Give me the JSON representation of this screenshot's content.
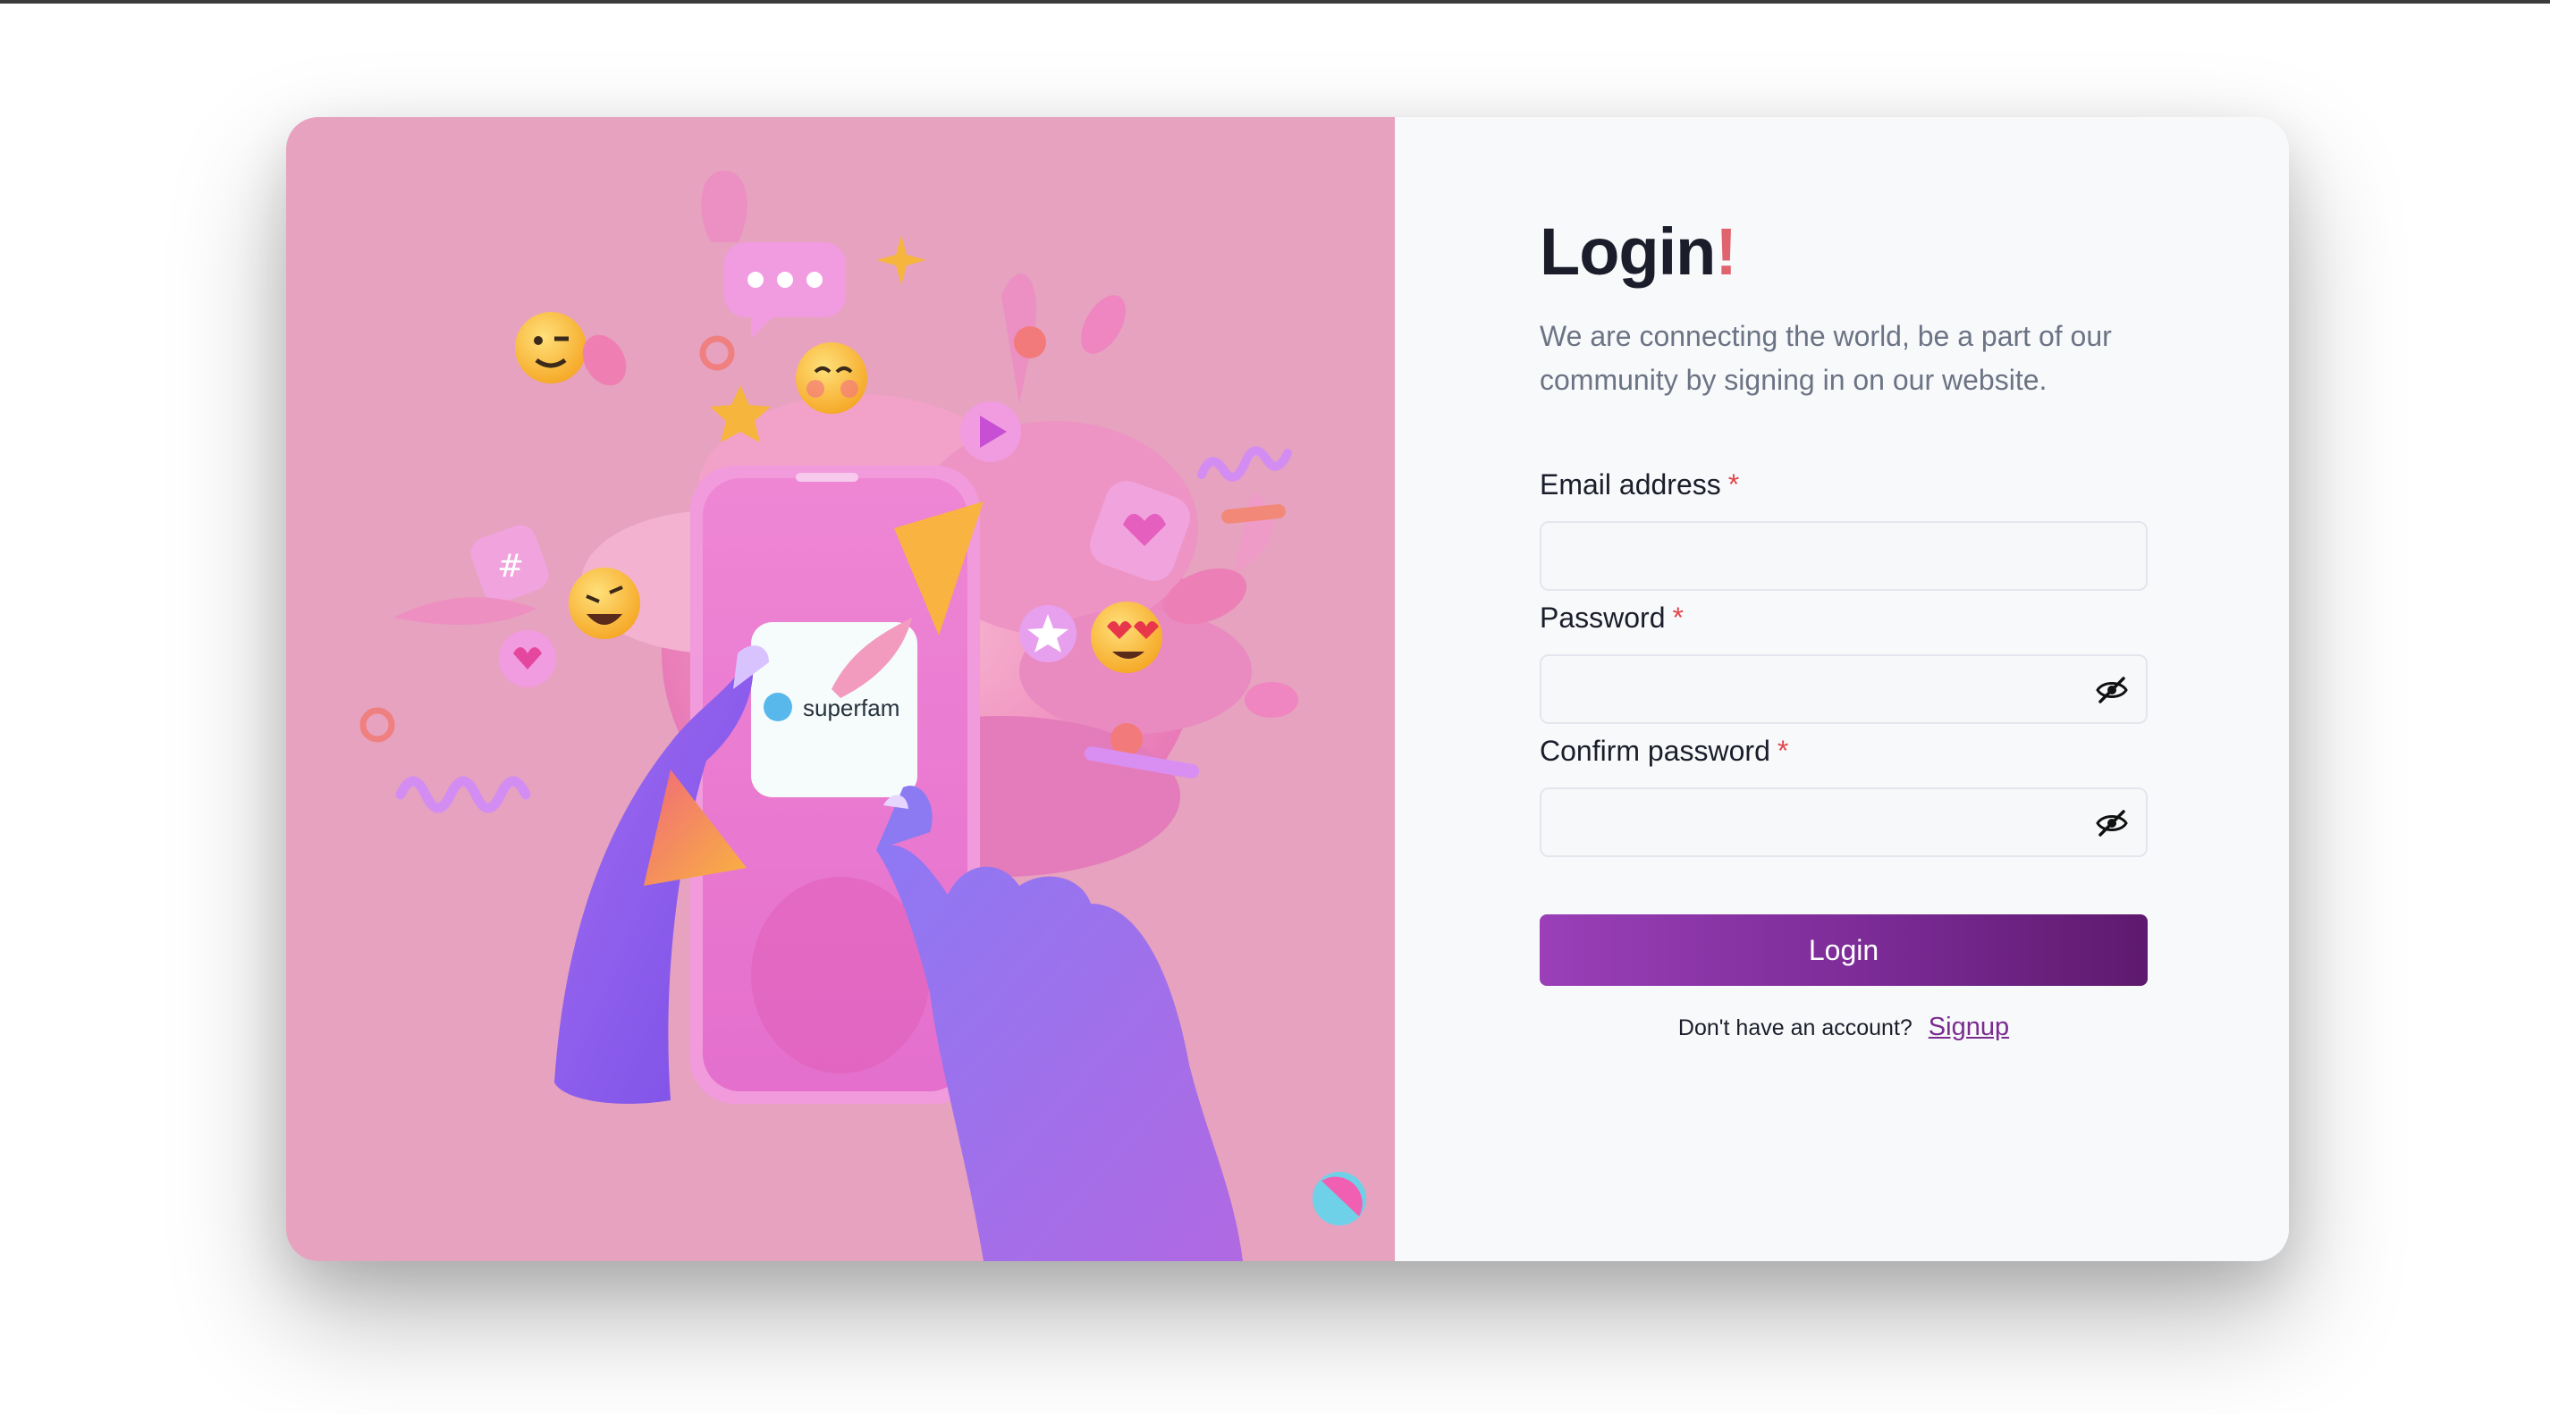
{
  "hero": {
    "brand_name": "superfam"
  },
  "form": {
    "title": "Login",
    "title_accent": "!",
    "subtitle": "We are connecting the world, be a part of our community by signing in on our website.",
    "required_marker": "*",
    "email": {
      "label": "Email address",
      "value": "",
      "placeholder": ""
    },
    "password": {
      "label": "Password",
      "value": "",
      "placeholder": "",
      "toggle_icon": "eye-off-icon"
    },
    "confirm_password": {
      "label": "Confirm password",
      "value": "",
      "placeholder": "",
      "toggle_icon": "eye-off-icon"
    },
    "submit_label": "Login",
    "signup_prompt": "Don't have an account?",
    "signup_link": "Signup"
  },
  "colors": {
    "hero_background": "#e6a2bf",
    "panel_background": "#f8f9fb",
    "accent": "#e0646f",
    "button_start": "#9a3fb8",
    "button_end": "#5e1a6e",
    "link": "#7a2c8f"
  }
}
